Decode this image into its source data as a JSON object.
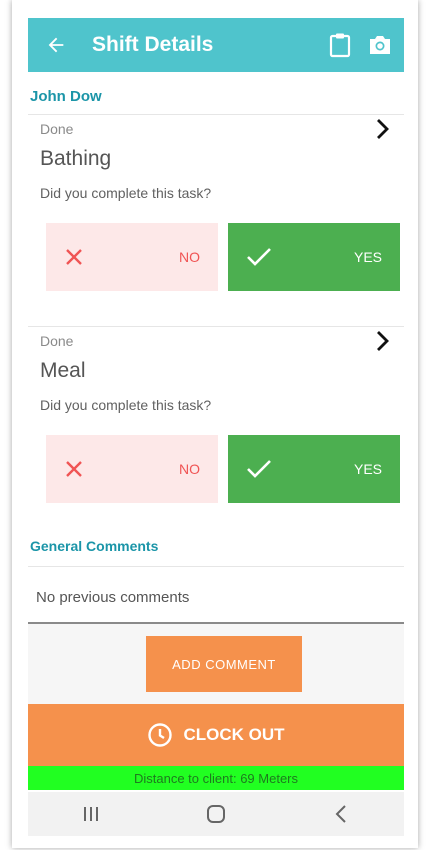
{
  "header": {
    "title": "Shift Details",
    "back_icon": "arrow-left-icon",
    "clipboard_icon": "clipboard-icon",
    "camera_icon": "camera-icon",
    "bg_color": "#4fc4cc"
  },
  "client": {
    "name": "John Dow"
  },
  "tasks": [
    {
      "status": "Done",
      "name": "Bathing",
      "question": "Did you complete this task?",
      "no_label": "NO",
      "yes_label": "YES"
    },
    {
      "status": "Done",
      "name": "Meal",
      "question": "Did you complete this task?",
      "no_label": "NO",
      "yes_label": "YES"
    }
  ],
  "comments": {
    "section_title": "General Comments",
    "empty_text": "No previous comments",
    "add_label": "ADD COMMENT"
  },
  "clock_out": {
    "label": "CLOCK OUT",
    "icon": "clock-icon"
  },
  "distance": {
    "text": "Distance to client: 69 Meters"
  },
  "colors": {
    "accent": "#1b95a8",
    "yes": "#4caf50",
    "no_bg": "#fde8e8",
    "no_fg": "#f05454",
    "orange": "#f5914c",
    "distance_bg": "#21ff21"
  }
}
